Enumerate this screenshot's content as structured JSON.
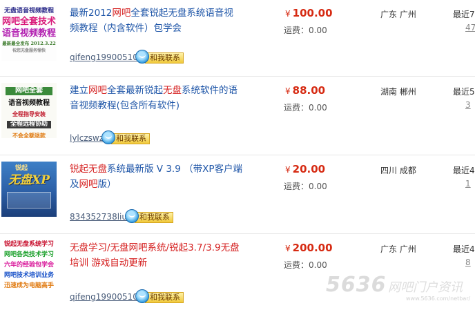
{
  "listings": [
    {
      "thumb_lines": [
        "无盘语音视频教程",
        "网吧全套技术",
        "语音视频教程",
        "最新最全发布 2012.3.22",
        "祝您无盘服务愉快"
      ],
      "title": "最新2012网吧全套锐起无盘系统语音视频教程（内含软件）包学会",
      "seller": "qifeng19900510",
      "contact_label": "和我联系",
      "currency": "¥",
      "price": "100.00",
      "shipping": "运费：0.00",
      "location": "广东 广州",
      "recent": "最近7",
      "count": "47"
    },
    {
      "thumb_lines": [
        "网吧全套",
        "语音视频教程",
        "全程指导安装",
        "全程远程协助",
        "不会全额退款"
      ],
      "title": "建立网吧全套最新锐起无盘系统软件的语音视频教程(包含所有软件)",
      "seller": "lylczswz",
      "contact_label": "和我联系",
      "currency": "¥",
      "price": "88.00",
      "shipping": "运费：0.00",
      "location": "湖南 郴州",
      "recent": "最近5",
      "count": "3"
    },
    {
      "thumb_lines": [
        "锐起",
        "无盘XP"
      ],
      "title": "锐起无盘系统最新版 V 3.9 （带XP客户端及网吧版）",
      "seller": "834352738liu",
      "contact_label": "和我联系",
      "currency": "¥",
      "price": "20.00",
      "shipping": "运费：0.00",
      "location": "四川 成都",
      "recent": "最近4",
      "count": "1"
    },
    {
      "thumb_lines": [
        "锐起无盘系统学习",
        "网吧各类技术学习",
        "六年的经验包学会",
        "网吧技术培训业务",
        "迅速成为电脑高手"
      ],
      "title": "无盘学习/无盘网吧系统/锐起3.7/3.9无盘培训 游戏自动更新",
      "seller": "qifeng19900510",
      "contact_label": "和我联系",
      "currency": "¥",
      "price": "200.00",
      "shipping": "运费：0.00",
      "location": "广东 广州",
      "recent": "最近4",
      "count": "8"
    }
  ],
  "watermark": {
    "number": "5636",
    "text": "网吧门户资讯",
    "url": "www.5636.com/netbar/"
  },
  "colors": {
    "title": "#1f56a8",
    "highlight": "#d52020",
    "price": "#d62a12",
    "separator": "#e6e6e6"
  }
}
